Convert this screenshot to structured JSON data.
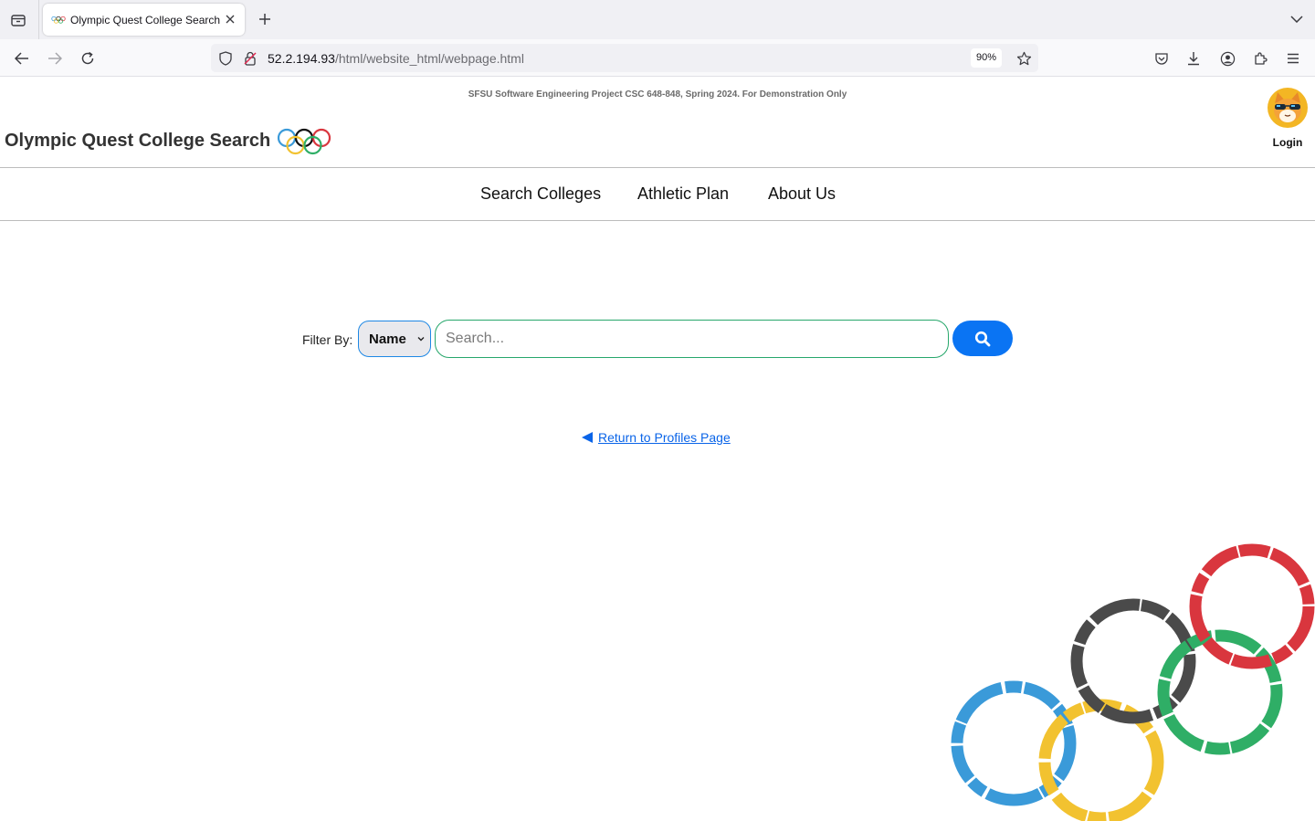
{
  "browser": {
    "tab_title": "Olympic Quest College Search",
    "url_host": "52.2.194.93",
    "url_path": "/html/website_html/webpage.html",
    "zoom": "90%"
  },
  "page": {
    "disclaimer": "SFSU Software Engineering Project CSC 648-848, Spring 2024. For Demonstration Only",
    "site_title": "Olympic Quest College Search",
    "login_label": "Login",
    "nav": [
      "Search Colleges",
      "Athletic Plan",
      "About Us"
    ],
    "filter_label": "Filter By:",
    "filter_selected": "Name",
    "search_placeholder": "Search...",
    "return_link": "Return to Profiles Page"
  },
  "colors": {
    "accent_blue": "#0a74f3",
    "link_blue": "#0a64e8",
    "input_border_green": "#27a76b",
    "ring_blue": "#3a9ad9",
    "ring_yellow": "#f2c230",
    "ring_black": "#4a4a4a",
    "ring_green": "#2fae66",
    "ring_red": "#d9363e"
  },
  "icons": [
    "tab-list-icon",
    "olympic-rings-favicon",
    "close-icon",
    "plus-icon",
    "chevron-down-icon",
    "back-arrow-icon",
    "forward-arrow-icon",
    "reload-icon",
    "shield-icon",
    "insecure-lock-icon",
    "star-icon",
    "pocket-icon",
    "download-icon",
    "account-icon",
    "extensions-icon",
    "menu-icon",
    "search-icon",
    "left-triangle-icon"
  ]
}
